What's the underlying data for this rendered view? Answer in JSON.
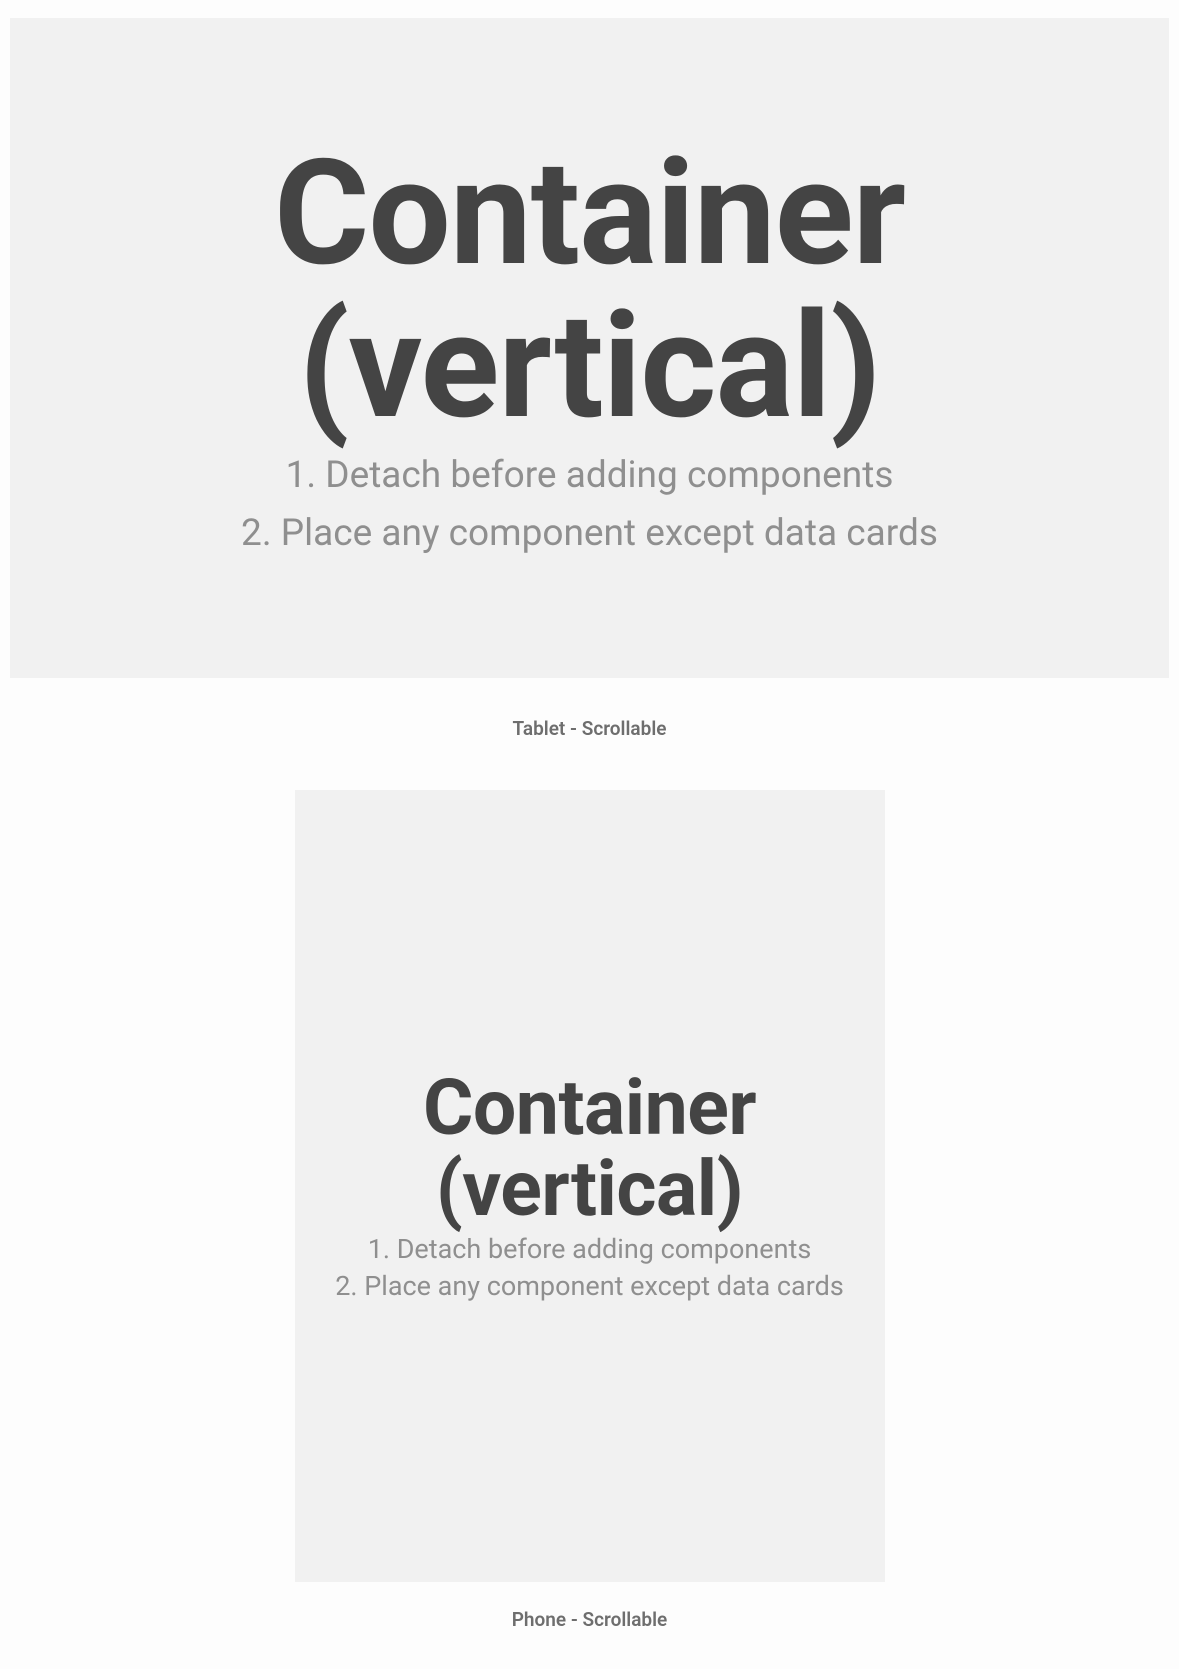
{
  "tablet": {
    "title_line1": "Container",
    "title_line2": "(vertical)",
    "instr1": "1. Detach before adding components",
    "instr2": "2. Place any component except data cards",
    "caption": "Tablet - Scrollable"
  },
  "phone": {
    "title_line1": "Container",
    "title_line2": "(vertical)",
    "instr1": "1. Detach before adding components",
    "instr2": "2. Place any component except data cards",
    "caption": "Phone - Scrollable"
  }
}
